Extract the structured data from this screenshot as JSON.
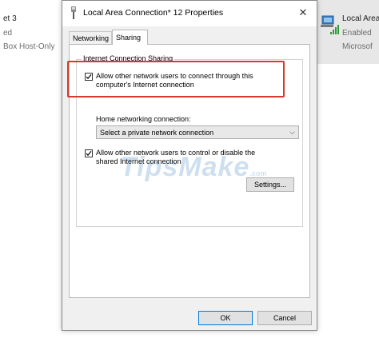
{
  "background_left": {
    "line1": "et 3",
    "line2": "ed",
    "line3": "Box Host-Only"
  },
  "background_right": {
    "name": "Local Area",
    "status": "Enabled",
    "device": "Microsof"
  },
  "dialog": {
    "title": "Local Area Connection* 12 Properties",
    "close_glyph": "✕",
    "tabs": [
      {
        "label": "Networking",
        "active": false
      },
      {
        "label": "Sharing",
        "active": true
      }
    ],
    "group_title": "Internet Connection Sharing",
    "allow_connect": {
      "checked": true,
      "label_line1": "Allow other network users to connect through this",
      "label_line2": "computer's Internet connection"
    },
    "home_networking_label": "Home networking connection:",
    "home_networking_select": {
      "value": "Select a private network connection",
      "arrow": "⌵"
    },
    "allow_control": {
      "checked": true,
      "label_line1": "Allow other network users to control or disable the",
      "label_line2": "shared Internet connection"
    },
    "settings_button": "Settings...",
    "ok_button": "OK",
    "cancel_button": "Cancel"
  },
  "watermark": {
    "text": "TipsMake",
    "suffix": ".com"
  },
  "colors": {
    "highlight_border": "#d63a2f",
    "dialog_bg": "#f0f0f0",
    "primary_border": "#0078d7"
  }
}
